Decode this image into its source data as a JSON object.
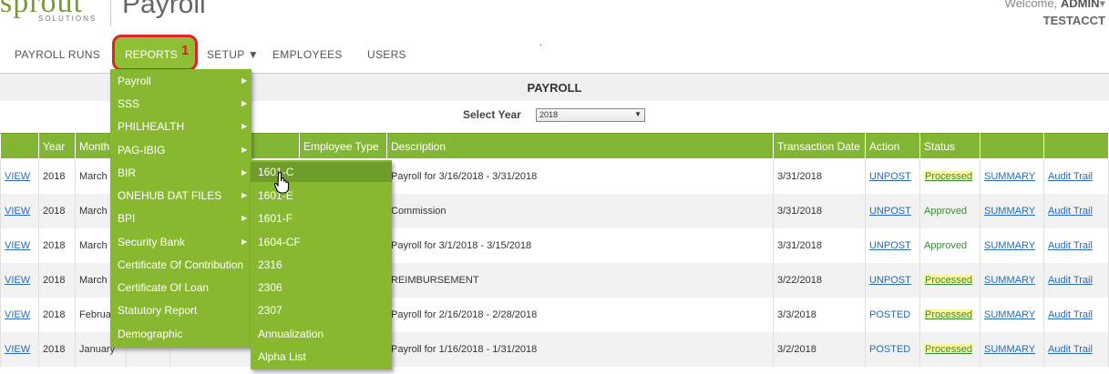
{
  "header": {
    "brand": "sprout",
    "brand_sub": "SOLUTIONS",
    "app_title": "Payroll",
    "welcome": "Welcome,",
    "user": "ADMIN",
    "account": "TESTACCT"
  },
  "nav": {
    "payroll_runs": "PAYROLL RUNS",
    "reports": "REPORTS",
    "reports_badge": "1",
    "setup": "SETUP ▼",
    "employees": "EMPLOYEES",
    "users": "USERS"
  },
  "section": {
    "title": "PAYROLL",
    "year_label": "Select Year",
    "year_value": "2018"
  },
  "table": {
    "headers": [
      "",
      "Year",
      "Month",
      "",
      "",
      "Employee Type",
      "Description",
      "Transaction Date",
      "Action",
      "Status",
      "",
      ""
    ],
    "rows": [
      {
        "view": "VIEW",
        "year": "2018",
        "month": "March",
        "desc": "Payroll for 3/16/2018 - 3/31/2018",
        "date": "3/31/2018",
        "action": "UNPOST",
        "status": "Processed",
        "summary": "SUMMARY",
        "audit": "Audit Trail"
      },
      {
        "view": "VIEW",
        "year": "2018",
        "month": "March",
        "desc": "Commission",
        "date": "3/31/2018",
        "action": "UNPOST",
        "status": "Approved",
        "summary": "SUMMARY",
        "audit": "Audit Trail"
      },
      {
        "view": "VIEW",
        "year": "2018",
        "month": "March",
        "desc": "Payroll for 3/1/2018 - 3/15/2018",
        "date": "3/31/2018",
        "action": "UNPOST",
        "status": "Approved",
        "summary": "SUMMARY",
        "audit": "Audit Trail"
      },
      {
        "view": "VIEW",
        "year": "2018",
        "month": "March",
        "desc": "REIMBURSEMENT",
        "date": "3/22/2018",
        "action": "UNPOST",
        "status": "Processed",
        "summary": "SUMMARY",
        "audit": "Audit Trail"
      },
      {
        "view": "VIEW",
        "year": "2018",
        "month": "Februa",
        "desc": "Payroll for 2/16/2018 - 2/28/2018",
        "date": "3/3/2018",
        "action": "POSTED",
        "status": "Processed",
        "summary": "SUMMARY",
        "audit": "Audit Trail"
      },
      {
        "view": "VIEW",
        "year": "2018",
        "month": "January",
        "desc": "Payroll for 1/16/2018 - 1/31/2018",
        "date": "3/2/2018",
        "action": "POSTED",
        "status": "Processed",
        "summary": "SUMMARY",
        "audit": "Audit Trail"
      }
    ]
  },
  "reports_menu": {
    "items": [
      "Payroll",
      "SSS",
      "PHILHEALTH",
      "PAG-IBIG",
      "BIR",
      "ONEHUB DAT FILES",
      "BPI",
      "Security Bank",
      "Certificate Of Contribution",
      "Certificate Of Loan",
      "Statutory Report",
      "Demographic"
    ]
  },
  "bir_submenu": {
    "items": [
      "1601-C",
      "1601-E",
      "1601-F",
      "1604-CF",
      "2316",
      "2306",
      "2307",
      "Annualization",
      "Alpha List"
    ]
  }
}
